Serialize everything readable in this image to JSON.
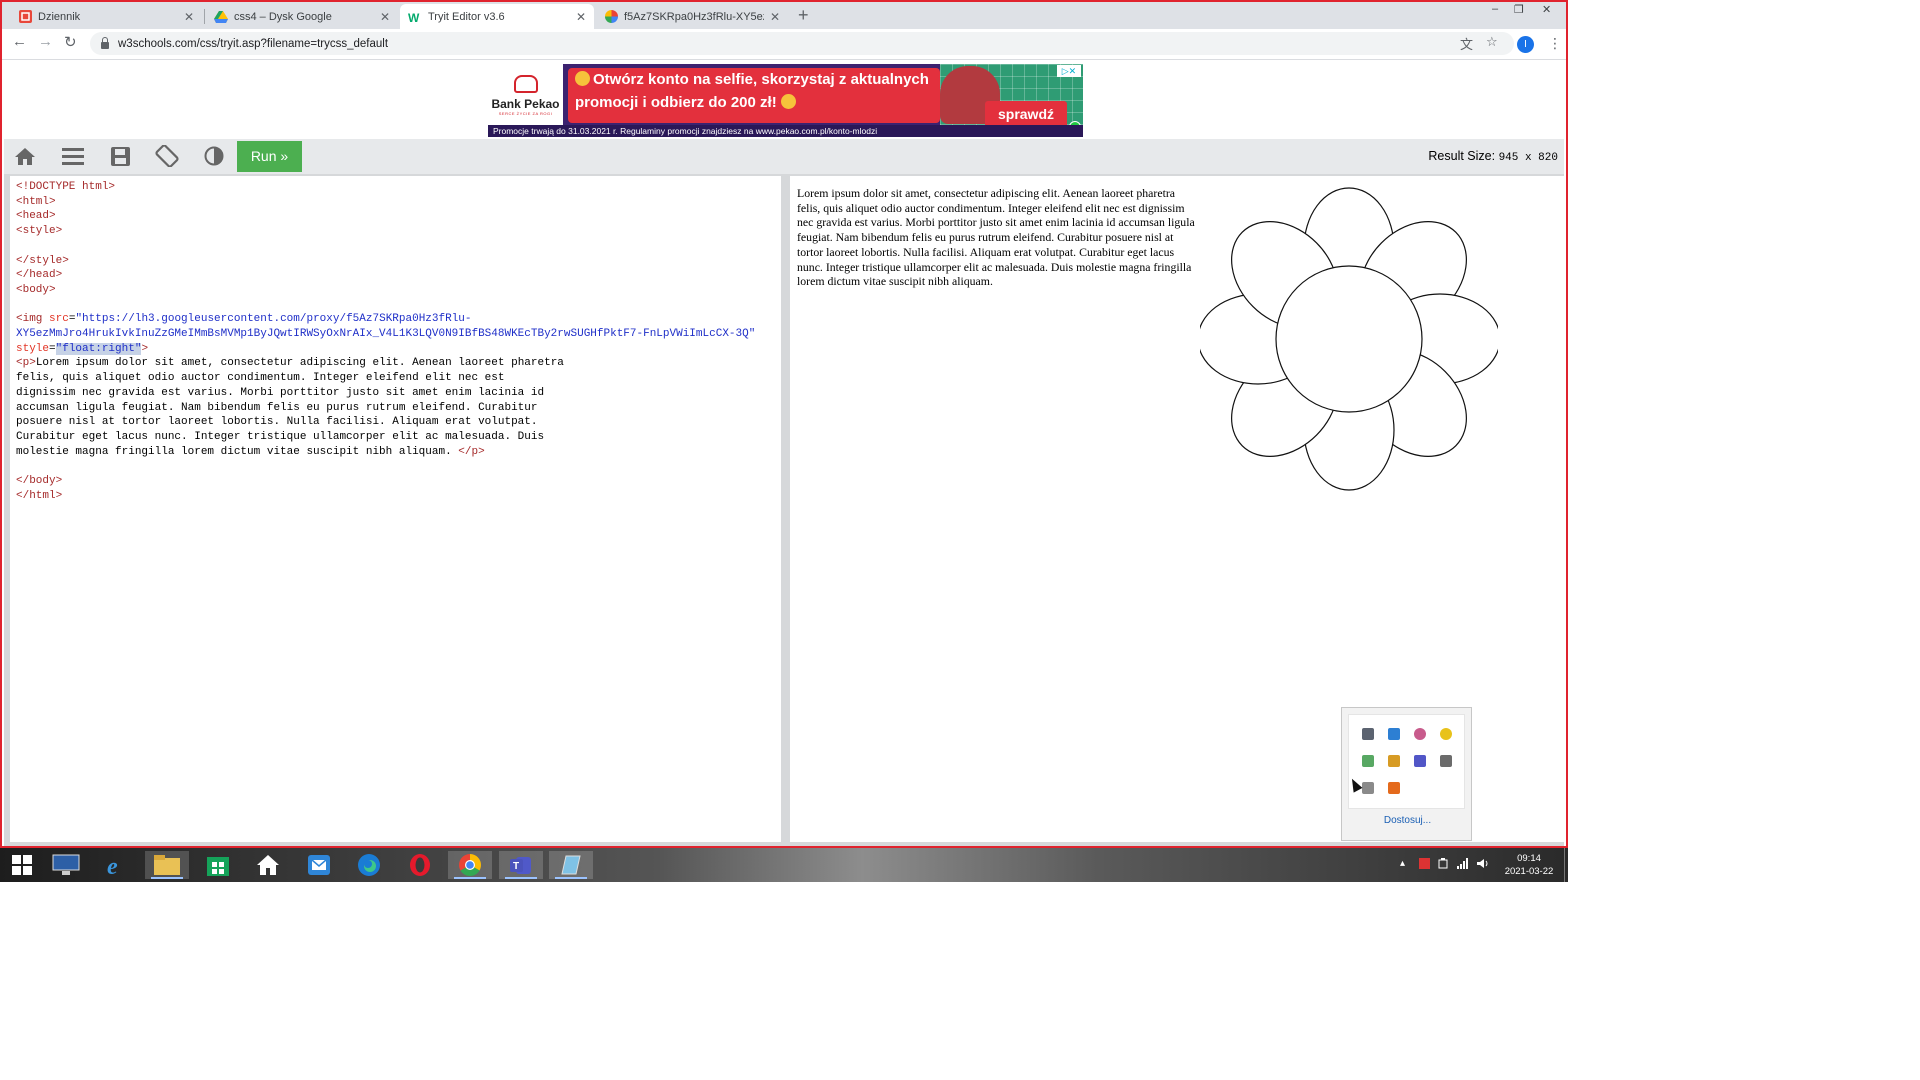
{
  "browser": {
    "tabs": [
      {
        "title": "Dziennik",
        "icon": "dziennik-icon",
        "active": false
      },
      {
        "title": "css4 – Dysk Google",
        "icon": "google-drive-icon",
        "active": false
      },
      {
        "title": "Tryit Editor v3.6",
        "icon": "w3schools-icon",
        "active": true
      },
      {
        "title": "f5Az7SKRpa0Hz3fRlu-XY5ezMm...",
        "icon": "image-icon",
        "active": false
      }
    ],
    "close_glyph": "✕",
    "new_tab_glyph": "+",
    "window_minimize": "–",
    "window_restore": "❐",
    "window_close": "✕",
    "back_glyph": "←",
    "forward_glyph": "→",
    "reload_glyph": "↻",
    "url": "w3schools.com/css/tryit.asp?filename=trycss_default",
    "translate_glyph": "文",
    "bookmark_glyph": "☆",
    "profile_initial": "I",
    "menu_glyph": "⋮"
  },
  "ad": {
    "bank_name": "Bank Pekao",
    "tagline": "SERCE ŻYCIE ZA ROGI",
    "headline_line1": "Otwórz konto na selfie, skorzystaj z aktualnych",
    "headline_line2": "promocji i odbierz do 200 zł!",
    "cta": "sprawdź",
    "footer": "Promocje trwają do 31.03.2021 r. Regulaminy promocji znajdziesz na www.pekao.com.pl/konto-mlodzi",
    "choices_label": "▷✕",
    "colors": {
      "brand": "#e3303d",
      "background": "#3c2270",
      "accent": "#2f9c74"
    }
  },
  "tryit": {
    "toolbar_icons": [
      "home-icon",
      "menu-icon",
      "save-icon",
      "rotate-icon",
      "contrast-icon"
    ],
    "run_label": "Run »",
    "result_size_label": "Result Size:",
    "result_size_value": "945 x 820",
    "run_color": "#4caf50"
  },
  "editor": {
    "doctype": "<!DOCTYPE html>",
    "html_open": "<html>",
    "head_open": "<head>",
    "style_open": "<style>",
    "style_close": "</style>",
    "head_close": "</head>",
    "body_open": "<body>",
    "img_open": "<img ",
    "img_src_attr": "src",
    "eq": "=",
    "img_src_line1": "\"https://lh3.googleusercontent.com/proxy/f5Az7SKRpa0Hz3fRlu-",
    "img_src_line2": "XY5ezMmJro4HrukIvkInuZzGMeIMmBsMVMp1ByJQwtIRWSyOxNrAIx_V4L1K3LQV0N9IBfBS48WKEcTBy2rwSUGHfPktF7-FnLpVWiImLcCX-3Q\"",
    "img_style_attr": "style",
    "img_style_value": "\"float:right\"",
    "img_close": ">",
    "p_open": "<p>",
    "paragraph_lines": [
      "Lorem ipsum dolor sit amet, consectetur adipiscing elit. Aenean laoreet pharetra",
      "felis, quis aliquet odio auctor condimentum. Integer eleifend elit nec est",
      "dignissim nec gravida est varius. Morbi porttitor justo sit amet enim lacinia id",
      "accumsan ligula feugiat. Nam bibendum felis eu purus rutrum eleifend. Curabitur",
      "posuere nisl at tortor laoreet lobortis. Nulla facilisi. Aliquam erat volutpat.",
      "Curabitur eget lacus nunc. Integer tristique ullamcorper elit ac malesuada. Duis",
      "molestie magna fringilla lorem dictum vitae suscipit nibh aliquam. "
    ],
    "p_close": "</p>",
    "body_close": "</body>",
    "html_close": "</html>"
  },
  "result": {
    "paragraph": "Lorem ipsum dolor sit amet, consectetur adipiscing elit. Aenean laoreet pharetra felis, quis aliquet odio auctor condimentum. Integer eleifend elit nec est dignissim nec gravida est varius. Morbi porttitor justo sit amet enim lacinia id accumsan ligula feugiat. Nam bibendum felis eu purus rutrum eleifend. Curabitur posuere nisl at tortor laoreet lobortis. Nulla facilisi. Aliquam erat volutpat. Curabitur eget lacus nunc. Integer tristique ullamcorper elit ac malesuada. Duis molestie magna fringilla lorem dictum vitae suscipit nibh aliquam.",
    "image": "flower-drawing"
  },
  "tray_popup": {
    "icons": [
      "network-adapter-icon",
      "display-settings-icon",
      "bluetooth-icon",
      "update-icon",
      "security-check-icon",
      "package-icon",
      "teams-tray-icon",
      "usb-drive-icon",
      "printer-icon",
      "app-tray-icon"
    ],
    "customize_label": "Dostosuj..."
  },
  "taskbar": {
    "apps": [
      "start-button",
      "lenovo-icon",
      "internet-explorer-icon",
      "file-explorer-icon",
      "store-icon",
      "home-icon",
      "mail-icon",
      "edge-icon",
      "opera-icon",
      "chrome-icon",
      "teams-icon",
      "notepad-icon"
    ],
    "time": "09:14",
    "date": "2021-03-22",
    "tray_up_glyph": "▴"
  }
}
